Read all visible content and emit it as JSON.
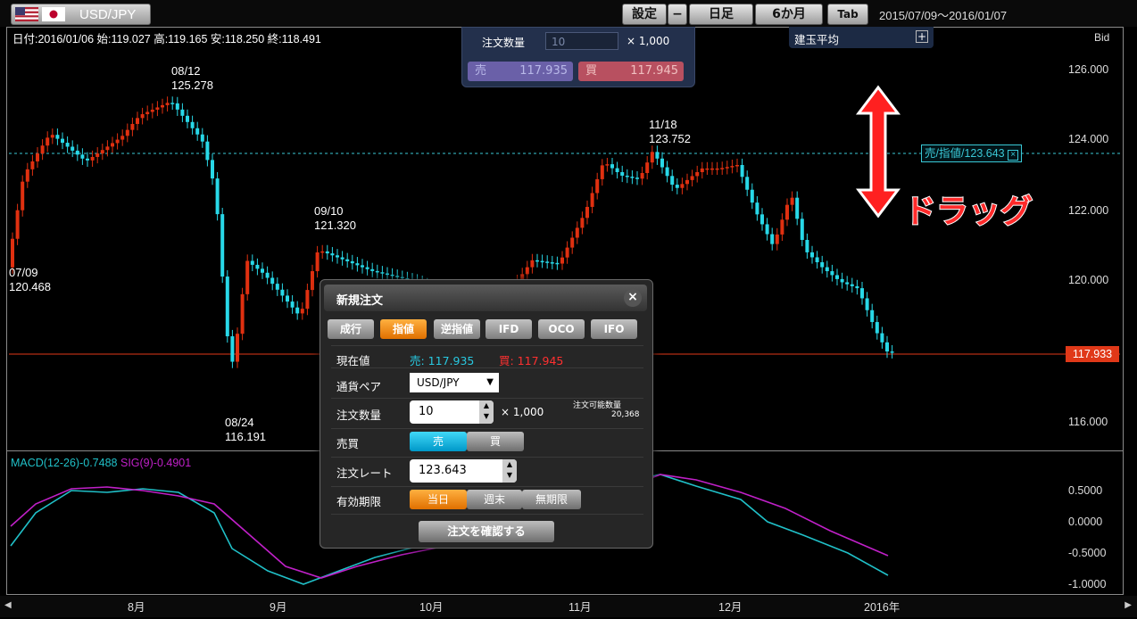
{
  "pair": {
    "symbol": "USD/JPY"
  },
  "toolbar": {
    "settings": "設定",
    "minus": "−",
    "timeframe": "日足",
    "period": "6か月",
    "tab": "Tab",
    "range": "2015/07/09～2016/01/07"
  },
  "info_line": "日付:2016/01/06 始:119.027 高:119.165 安:118.250 終:118.491",
  "price_type": "Bid",
  "order_panel": {
    "qty_label": "注文数量",
    "qty_value": "10",
    "unit": "× 1,000",
    "sell_label": "売",
    "sell_price": "117.935",
    "buy_label": "買",
    "buy_price": "117.945"
  },
  "avg_box": {
    "label": "建玉平均",
    "toggle": "+"
  },
  "y_ticks": [
    {
      "label": "126.000",
      "value": 126.0
    },
    {
      "label": "124.000",
      "value": 124.0
    },
    {
      "label": "122.000",
      "value": 122.0
    },
    {
      "label": "120.000",
      "value": 120.0
    },
    {
      "label": "116.000",
      "value": 116.0
    }
  ],
  "x_ticks": [
    "8月",
    "9月",
    "10月",
    "11月",
    "12月",
    "2016年"
  ],
  "annotations": [
    {
      "date": "07/09",
      "price": "120.468"
    },
    {
      "date": "08/12",
      "price": "125.278"
    },
    {
      "date": "09/10",
      "price": "121.320"
    },
    {
      "date": "08/24",
      "price": "116.191"
    },
    {
      "date": "11/18",
      "price": "123.752"
    }
  ],
  "limit_tag": "売/指値/123.643",
  "current_tag": "117.933",
  "drag_label": "ドラッグ",
  "macd": {
    "macd_text": "MACD(12-26)-0.7488",
    "sig_text": "SIG(9)-0.4901",
    "ticks": [
      "0.5000",
      "0.0000",
      "-0.5000",
      "-1.0000"
    ]
  },
  "dialog": {
    "title": "新規注文",
    "close": "×",
    "tabs": [
      "成行",
      "指値",
      "逆指値",
      "IFD",
      "OCO",
      "IFO"
    ],
    "active_tab": "指値",
    "current_label": "現在値",
    "current_sell": "売: 117.935",
    "current_buy": "買: 117.945",
    "pair_label": "通貨ペア",
    "pair_value": "USD/JPY",
    "qty_label": "注文数量",
    "qty_value": "10",
    "qty_unit": "× 1,000",
    "avail_label": "注文可能数量",
    "avail_value": "20,368",
    "side_label": "売買",
    "side_sell": "売",
    "side_buy": "買",
    "rate_label": "注文レート",
    "rate_value": "123.643",
    "expiry_label": "有効期限",
    "expiry_options": [
      "当日",
      "週末",
      "無期限"
    ],
    "confirm": "注文を確認する"
  },
  "colors": {
    "up": "#e03010",
    "down": "#28d8e8",
    "macd": "#20c0c8",
    "signal": "#c020c8",
    "limit": "#3ac8d6",
    "current": "#e03818"
  }
}
